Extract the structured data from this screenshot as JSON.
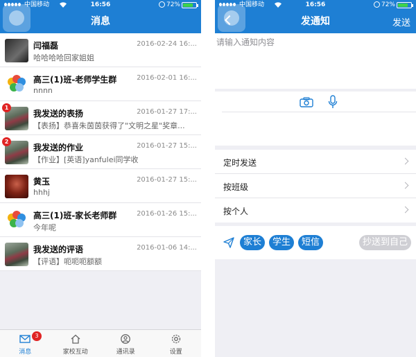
{
  "status": {
    "carrier": "中国移动",
    "time": "16:56",
    "battery": "72%",
    "battery_level": 0.72
  },
  "left": {
    "title": "消息",
    "messages": [
      {
        "name": "闫福磊",
        "date": "2016-02-24 16:...",
        "preview": "哈哈哈哈回家姐姐",
        "avatar": "dark-photo",
        "badge": ""
      },
      {
        "name": "高三(1)班-老师学生群",
        "date": "2016-02-01 16:...",
        "preview": "nnnn",
        "avatar": "group-flower",
        "badge": ""
      },
      {
        "name": "我发送的表扬",
        "date": "2016-01-27 17:...",
        "preview": "【表扬】恭喜朱茵茵获得了\"文明之星\"奖章...",
        "avatar": "road-photo",
        "badge": "1"
      },
      {
        "name": "我发送的作业",
        "date": "2016-01-27 15:...",
        "preview": "【作业】[英语]yanfulei同学收",
        "avatar": "road-photo",
        "badge": "2"
      },
      {
        "name": "黄玉",
        "date": "2016-01-27 15:...",
        "preview": "hhhj",
        "avatar": "red-photo",
        "badge": ""
      },
      {
        "name": "高三(1)班-家长老师群",
        "date": "2016-01-26 15:...",
        "preview": "今年呢",
        "avatar": "group-flower",
        "badge": ""
      },
      {
        "name": "我发送的评语",
        "date": "2016-01-06 14:...",
        "preview": "【评语】呃呃呃额额",
        "avatar": "road-photo",
        "badge": ""
      }
    ],
    "tabs": [
      {
        "label": "消息",
        "icon": "envelope-icon",
        "badge": "3"
      },
      {
        "label": "家校互动",
        "icon": "home-icon",
        "badge": ""
      },
      {
        "label": "通讯录",
        "icon": "contacts-icon",
        "badge": ""
      },
      {
        "label": "设置",
        "icon": "gear-icon",
        "badge": ""
      }
    ]
  },
  "right": {
    "title": "发通知",
    "send_label": "发送",
    "compose_placeholder": "请输入通知内容",
    "options": [
      {
        "label": "定时发送"
      },
      {
        "label": "按班级"
      },
      {
        "label": "按个人"
      }
    ],
    "recipients": [
      "家长",
      "学生",
      "短信"
    ],
    "cc_self": "抄送到自己"
  },
  "colors": {
    "accent": "#1e7fd4",
    "badge": "#e02424",
    "background": "#efeff4"
  }
}
